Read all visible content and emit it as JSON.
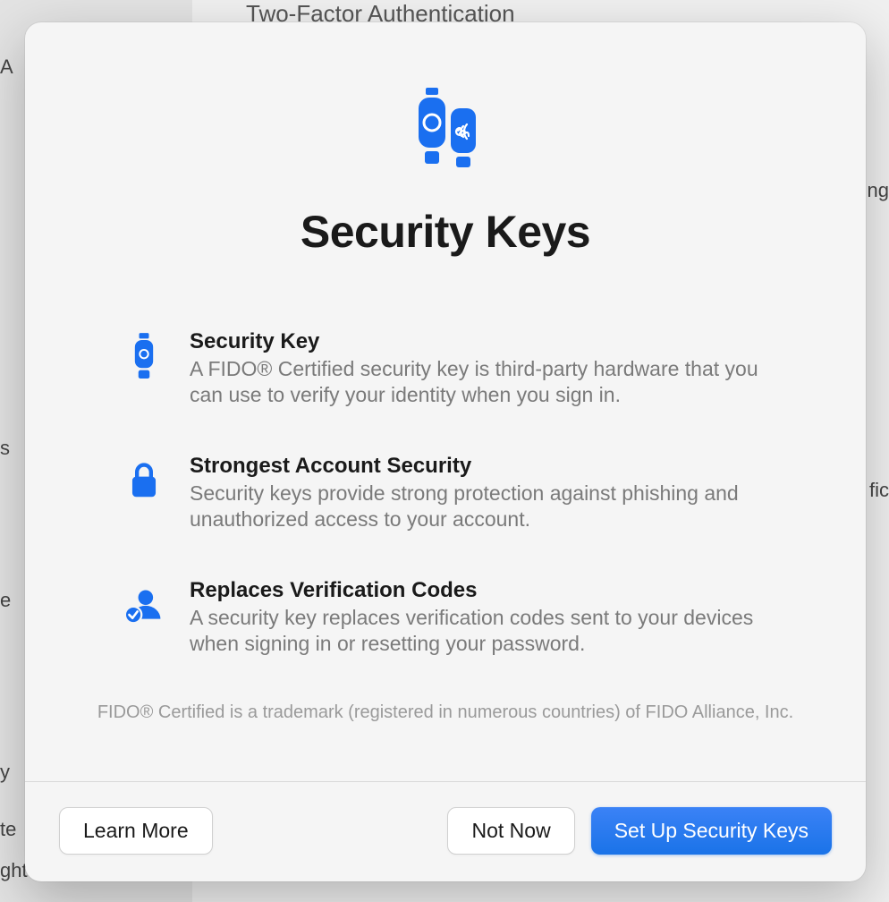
{
  "background": {
    "header": "Two-Factor Authentication",
    "right1": "ng",
    "right2": "fic",
    "left_items": [
      "A",
      "s",
      "e",
      "y",
      "te",
      "ght"
    ]
  },
  "modal": {
    "title": "Security Keys",
    "features": [
      {
        "title": "Security Key",
        "desc": "A FIDO® Certified security key is third-party hardware that you can use to verify your identity when you sign in."
      },
      {
        "title": "Strongest Account Security",
        "desc": "Security keys provide strong protection against phishing and unauthorized access to your account."
      },
      {
        "title": "Replaces Verification Codes",
        "desc": "A security key replaces verification codes sent to your devices when signing in or resetting your password."
      }
    ],
    "trademark": "FIDO® Certified is a trademark (registered in numerous countries) of FIDO Alliance, Inc.",
    "buttons": {
      "learn_more": "Learn More",
      "not_now": "Not Now",
      "setup": "Set Up Security Keys"
    }
  }
}
